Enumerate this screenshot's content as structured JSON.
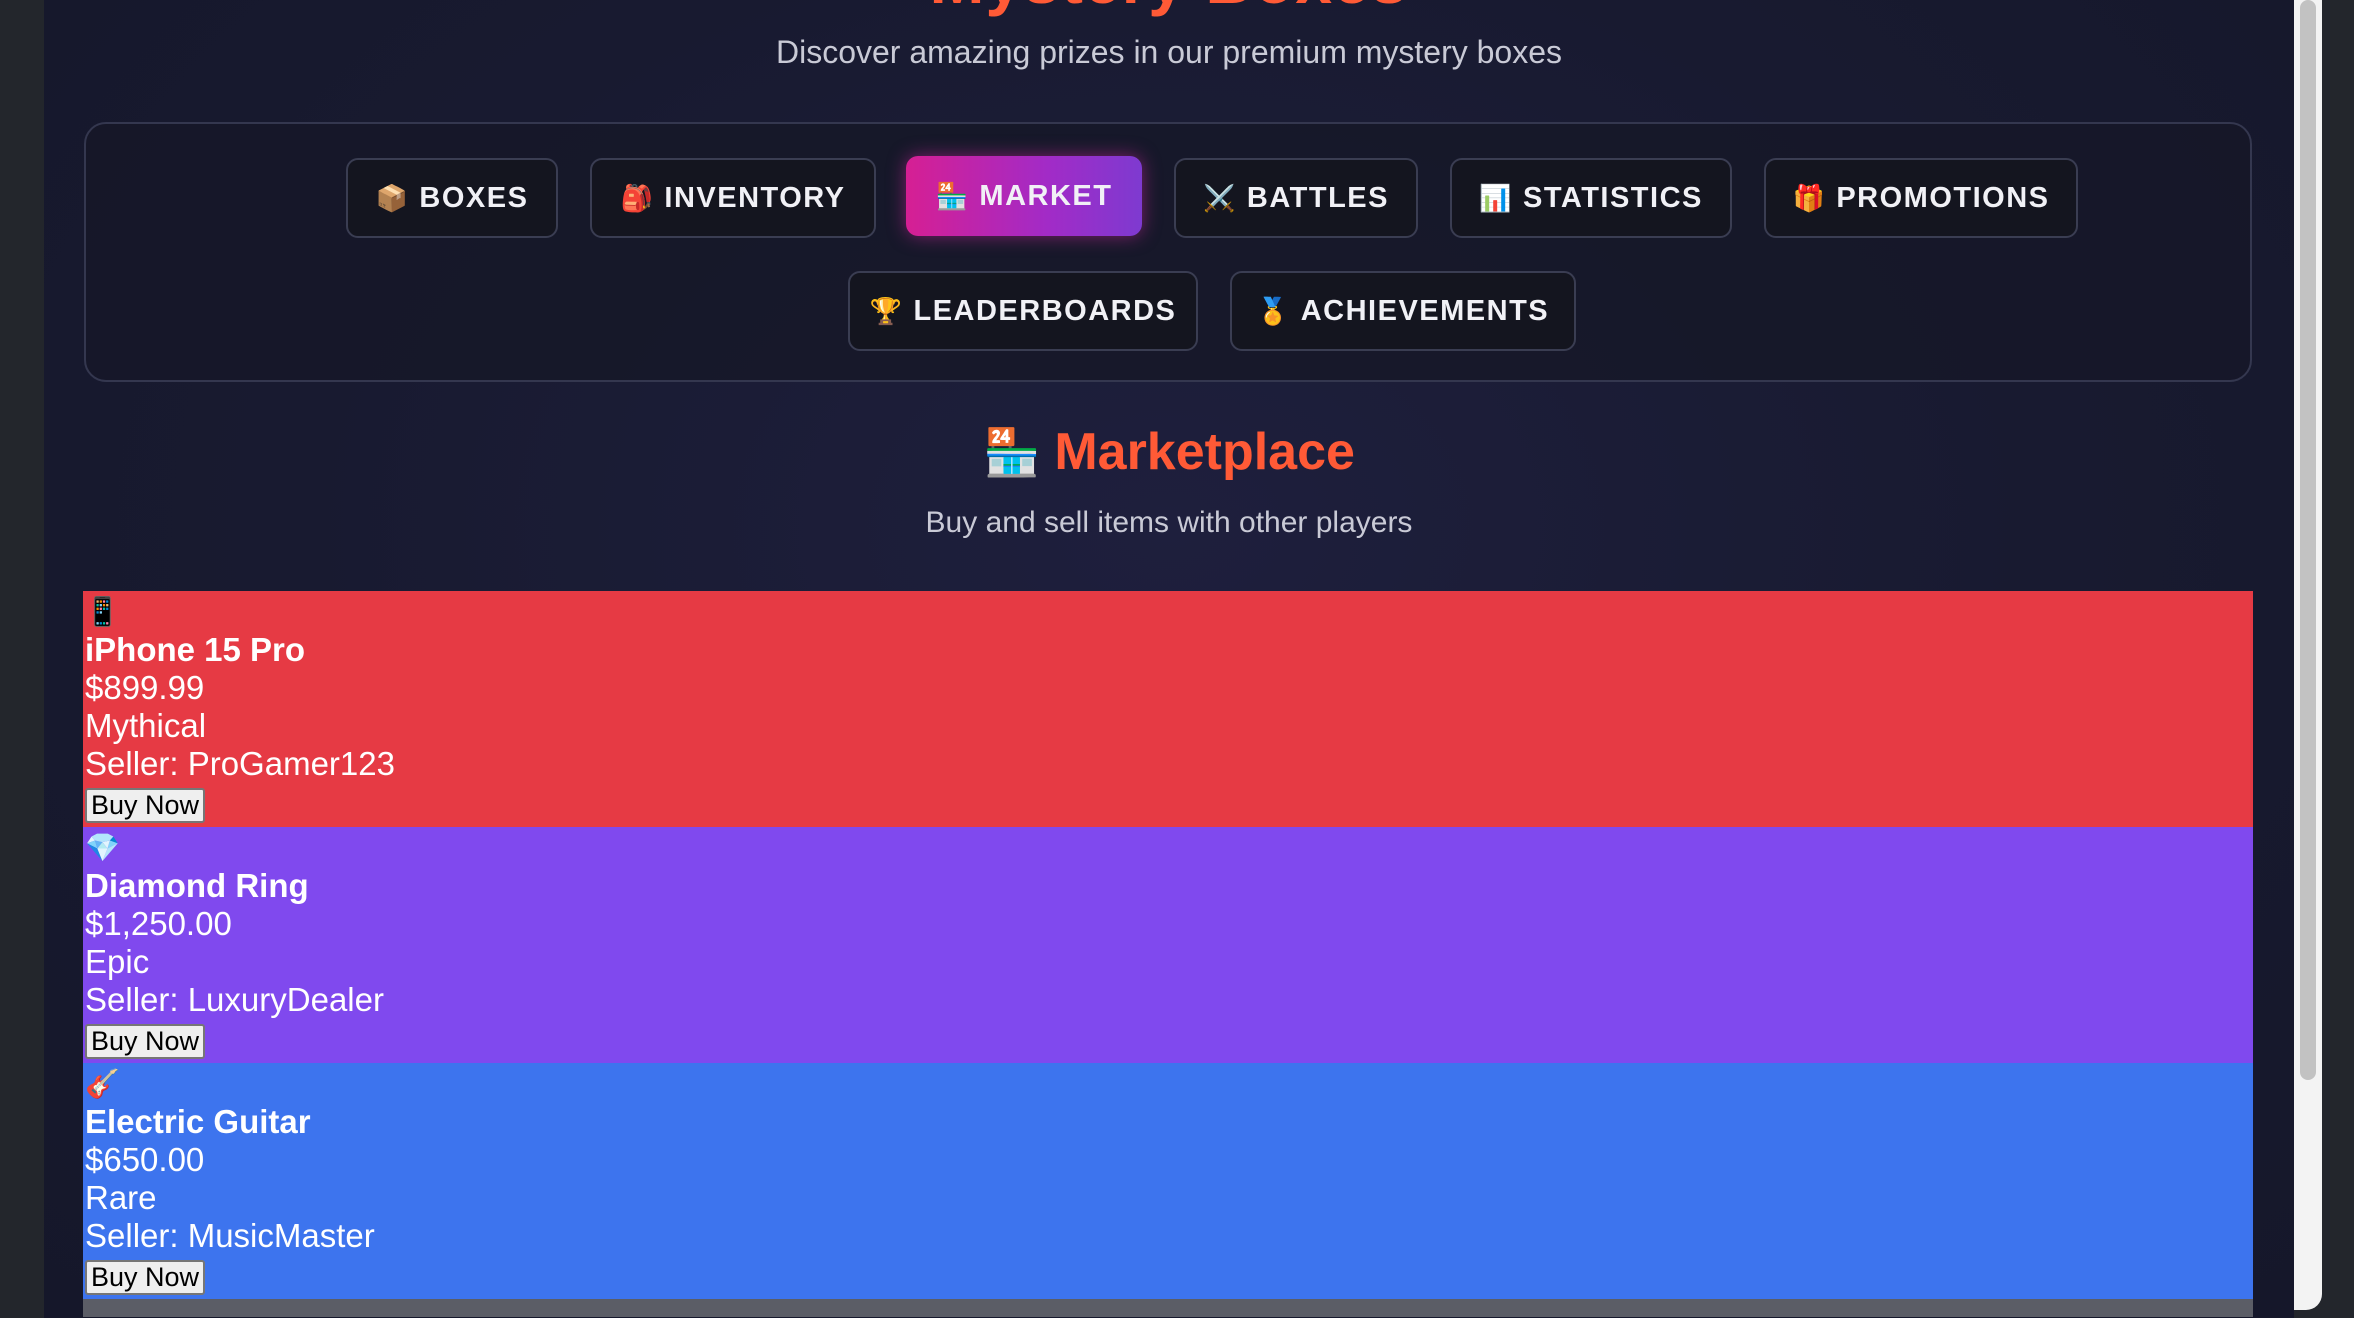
{
  "header": {
    "title": "Mystery Boxes",
    "subtitle": "Discover amazing prizes in our premium mystery boxes"
  },
  "nav": {
    "items": [
      {
        "icon": "📦",
        "label": "BOXES"
      },
      {
        "icon": "🎒",
        "label": "INVENTORY"
      },
      {
        "icon": "🏪",
        "label": "MARKET",
        "active": true
      },
      {
        "icon": "⚔️",
        "label": "BATTLES"
      },
      {
        "icon": "📊",
        "label": "STATISTICS"
      },
      {
        "icon": "🎁",
        "label": "PROMOTIONS"
      },
      {
        "icon": "🏆",
        "label": "LEADERBOARDS"
      },
      {
        "icon": "🏅",
        "label": "ACHIEVEMENTS"
      }
    ]
  },
  "section": {
    "icon": "🏪",
    "title": "Marketplace",
    "subtitle": "Buy and sell items with other players"
  },
  "listings": [
    {
      "icon": "📱",
      "name": "iPhone 15 Pro",
      "price": "$899.99",
      "rarity": "Mythical",
      "seller": "Seller: ProGamer123",
      "buy_label": "Buy Now",
      "color": "#e63a44"
    },
    {
      "icon": "💎",
      "name": "Diamond Ring",
      "price": "$1,250.00",
      "rarity": "Epic",
      "seller": "Seller: LuxuryDealer",
      "buy_label": "Buy Now",
      "color": "#8049ee"
    },
    {
      "icon": "🎸",
      "name": "Electric Guitar",
      "price": "$650.00",
      "rarity": "Rare",
      "seller": "Seller: MusicMaster",
      "buy_label": "Buy Now",
      "color": "#3d74ee"
    }
  ],
  "colors": {
    "accent": "#ff5a36",
    "active_gradient_start": "#d61f93",
    "active_gradient_end": "#7e3ad0",
    "background": "#181a30"
  }
}
